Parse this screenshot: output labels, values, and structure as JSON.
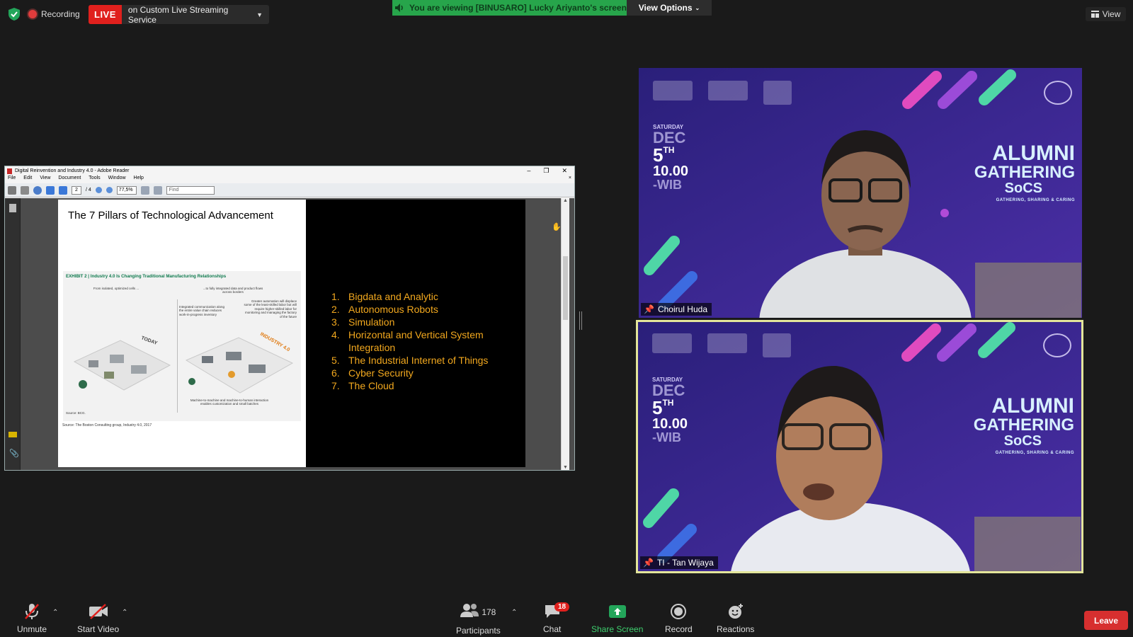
{
  "top_bar": {
    "recording_label": "Recording",
    "live_tag": "LIVE",
    "live_service": "on Custom Live Streaming Service",
    "viewing_text": "You are viewing [BINUSARO] Lucky Ariyanto's screen",
    "view_options_label": "View Options",
    "view_label": "View"
  },
  "adobe": {
    "title": "Digital Reinvention and Industry 4.0 - Adobe Reader",
    "menu": [
      "File",
      "Edit",
      "View",
      "Document",
      "Tools",
      "Window",
      "Help"
    ],
    "page_current": "2",
    "page_total": "/ 4",
    "zoom": "77,5%",
    "find_placeholder": "Find"
  },
  "slide": {
    "title": "The 7 Pillars of Technological Advancement",
    "exhibit_title": "EXHIBIT 2 | Industry 4.0 Is Changing Traditional Manufacturing Relationships",
    "left_caption": "From isolated, optimized cells ...",
    "right_caption": "...to fully integrated data and product flows across borders",
    "today_label": "TODAY",
    "industry_label": "INDUSTRY 4.0",
    "note_integrated": "Integrated communication along the entire value chain reduces work-in-progress inventory",
    "note_automation": "Greater automation will displace some of the least-skilled labor but will require higher-skilled labor for monitoring and managing the factory of the future",
    "note_m2m": "Machine-to-machine and machine-to-human interaction enables customization and small batches",
    "exhibit_source": "Source: BCG.",
    "source": "Source: The Boston Consulting group, Industry 4.0, 2017",
    "pillars": [
      {
        "num": "1.",
        "text": "Bigdata and Analytic"
      },
      {
        "num": "2.",
        "text": "Autonomous Robots"
      },
      {
        "num": "3.",
        "text": "Simulation"
      },
      {
        "num": "4.",
        "text": "Horizontal and Vertical System Integration"
      },
      {
        "num": "5.",
        "text": "The Industrial Internet of Things"
      },
      {
        "num": "6.",
        "text": "Cyber Security"
      },
      {
        "num": "7.",
        "text": "The Cloud"
      }
    ]
  },
  "banner": {
    "day": "SATURDAY",
    "month": "DEC",
    "date": "5",
    "date_suffix": "TH",
    "time": "10.00",
    "tz": "-WIB",
    "line1": "ALUMNI",
    "line2": "GATHERING",
    "line3": "SoCS",
    "tagline": "GATHERING, SHARING & CARING"
  },
  "participants": [
    {
      "name": "Choirul Huda"
    },
    {
      "name": "TI - Tan Wijaya"
    }
  ],
  "toolbar": {
    "unmute": "Unmute",
    "start_video": "Start Video",
    "participants_count": "178",
    "participants": "Participants",
    "chat": "Chat",
    "chat_badge": "18",
    "share_screen": "Share Screen",
    "record": "Record",
    "reactions": "Reactions",
    "leave": "Leave"
  },
  "colors": {
    "live_red": "#e0201d",
    "viewing_green": "#27a54b",
    "pillar_orange": "#f2a81e",
    "banner_purple": "#3a2a8e",
    "active_speaker_border": "#e3e59a"
  }
}
